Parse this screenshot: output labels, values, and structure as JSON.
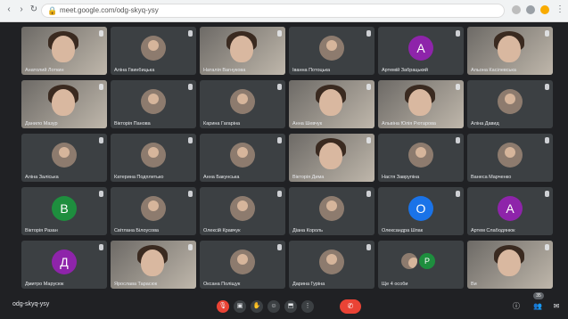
{
  "browser": {
    "url": "meet.google.com/odg-skyq-ysy"
  },
  "colors": {
    "tile_bg": "#3c4043",
    "meet_bg": "#202124",
    "end_call": "#ea4335"
  },
  "tiles": [
    {
      "name": "Анатолий Лоткин",
      "kind": "video"
    },
    {
      "name": "Аліна Гвинбицька",
      "kind": "photo"
    },
    {
      "name": "Наталія Вагнукова",
      "kind": "video"
    },
    {
      "name": "Іванна Потоцька",
      "kind": "photo"
    },
    {
      "name": "Артемій Забрацький",
      "kind": "letter",
      "letter": "А",
      "color": "#8e24aa"
    },
    {
      "name": "Альона Касілевська",
      "kind": "video"
    },
    {
      "name": "Данило Мазур",
      "kind": "video"
    },
    {
      "name": "Вікторія Панова",
      "kind": "photo"
    },
    {
      "name": "Карина Гагаріна",
      "kind": "photo"
    },
    {
      "name": "Анна Шевчук",
      "kind": "video"
    },
    {
      "name": "Альвіна Юлія Рютарова",
      "kind": "video"
    },
    {
      "name": "Аліна Давид",
      "kind": "photo"
    },
    {
      "name": "Аліна Заліська",
      "kind": "photo"
    },
    {
      "name": "Катерина Подплетько",
      "kind": "photo"
    },
    {
      "name": "Анна Бакунська",
      "kind": "photo"
    },
    {
      "name": "Вікторія Дима",
      "kind": "video"
    },
    {
      "name": "Настя Заврупіна",
      "kind": "photo"
    },
    {
      "name": "Ванеса Марченко",
      "kind": "photo"
    },
    {
      "name": "Вікторія Разан",
      "kind": "letter",
      "letter": "В",
      "color": "#1e8e3e"
    },
    {
      "name": "Світлана Білоусова",
      "kind": "photo"
    },
    {
      "name": "Олексій Кравчук",
      "kind": "photo"
    },
    {
      "name": "Діана Король",
      "kind": "photo"
    },
    {
      "name": "Олександра Шпак",
      "kind": "letter",
      "letter": "О",
      "color": "#1a73e8"
    },
    {
      "name": "Артем Слабодянюк",
      "kind": "letter",
      "letter": "А",
      "color": "#8e24aa"
    },
    {
      "name": "Дмитро Марусюк",
      "kind": "letter",
      "letter": "Д",
      "color": "#8e24aa"
    },
    {
      "name": "Ярослава Тарасюк",
      "kind": "video"
    },
    {
      "name": "Оксана Поліщук",
      "kind": "photo"
    },
    {
      "name": "Дарина Гуріна",
      "kind": "photo"
    },
    {
      "name": "Ще 4 особи",
      "kind": "more"
    },
    {
      "name": "Ви",
      "kind": "video"
    }
  ],
  "bottom": {
    "meeting_code": "odg-skyq-ysy",
    "participants_count": "35"
  }
}
